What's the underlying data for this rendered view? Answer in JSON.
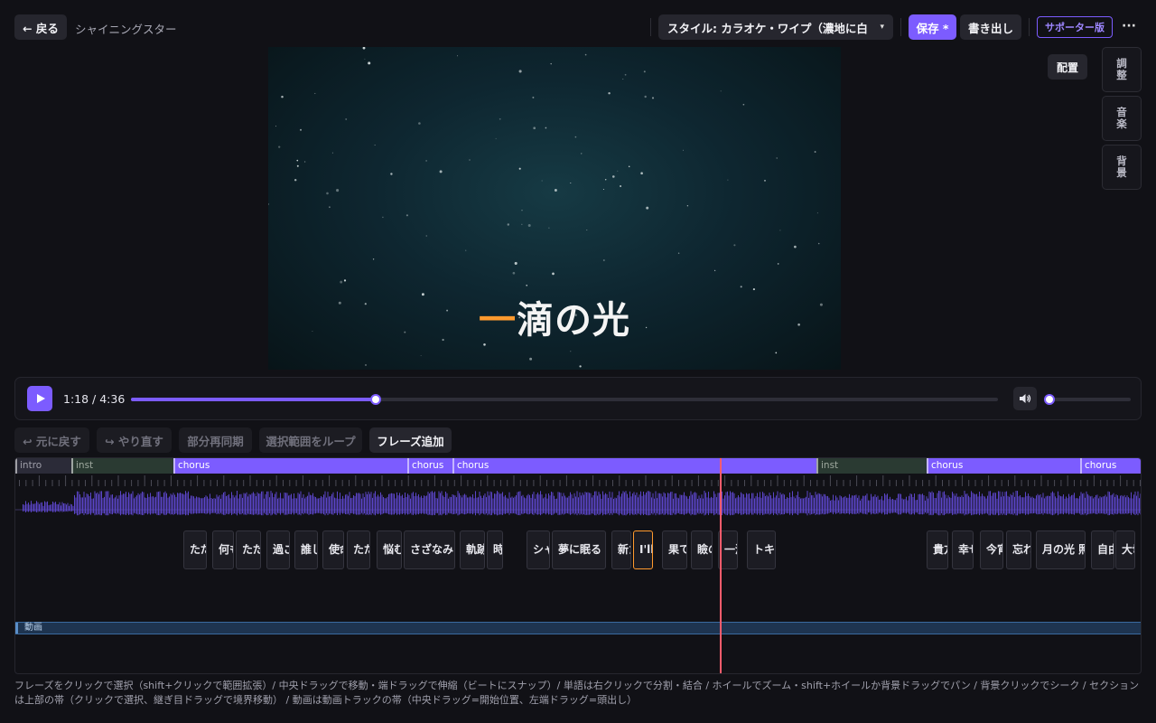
{
  "header": {
    "back_label": "← 戻る",
    "project_title": "シャイニングスター",
    "style_label": "スタイル: カラオケ・ワイプ（濃地に白…",
    "style_caret": "▾",
    "save_label": "保存 *",
    "export_label": "書き出し",
    "supporter_label": "サポーター版",
    "more_label": "···"
  },
  "preview": {
    "lyric_highlight": "一",
    "lyric_rest": "滴の光",
    "highlight_color": "#ff9a2e"
  },
  "side_panel": {
    "layout_label": "配置",
    "tabs": [
      {
        "line1": "調",
        "line2": "整"
      },
      {
        "line1": "音",
        "line2": "楽"
      },
      {
        "line1": "背",
        "line2": "景"
      }
    ]
  },
  "player": {
    "time_display": "1:18 / 4:36",
    "progress_fraction": 0.2826,
    "volume_fraction": 0.0,
    "accent_color": "#7c5cff"
  },
  "toolbar": {
    "undo_label": "↩ 元に戻す",
    "redo_label": "↪ やり直す",
    "resync_label": "部分再同期",
    "loop_label": "選択範囲をループ",
    "add_phrase_label": "フレーズ追加"
  },
  "timeline": {
    "sections": [
      {
        "label": "intro",
        "kind": "intro"
      },
      {
        "label": "inst",
        "kind": "inst"
      },
      {
        "label": "chorus",
        "kind": "chorus"
      },
      {
        "label": "chorus",
        "kind": "chorus"
      },
      {
        "label": "chorus",
        "kind": "chorus"
      },
      {
        "label": "inst",
        "kind": "inst"
      },
      {
        "label": "chorus",
        "kind": "chorus"
      },
      {
        "label": "chorus",
        "kind": "chorus"
      }
    ],
    "phrases": [
      "ただ",
      "何も",
      "ただ",
      "過ご",
      "誰し",
      "使命",
      "ただ",
      "悩む",
      "さざなみ",
      "軌跡",
      "時",
      "シャ",
      "夢に眠る",
      "新た",
      "I'll",
      "果て",
      "瞼の",
      "一滴",
      "トキ",
      "貴方",
      "幸せ",
      "今宵",
      "忘れ",
      "月の光 照",
      "自由",
      "大切"
    ],
    "selected_phrase": "I'll",
    "video_track_label": "動画"
  },
  "help_text": "フレーズをクリックで選択（shift+クリックで範囲拡張）/ 中央ドラッグで移動・端ドラッグで伸縮（ビートにスナップ）/ 単語は右クリックで分割・結合 / ホイールでズーム・shift+ホイールか背景ドラッグでパン / 背景クリックでシーク / セクションは上部の帯（クリックで選択、継ぎ目ドラッグで境界移動） / 動画は動画トラックの帯（中央ドラッグ=開始位置、左端ドラッグ=頭出し）"
}
